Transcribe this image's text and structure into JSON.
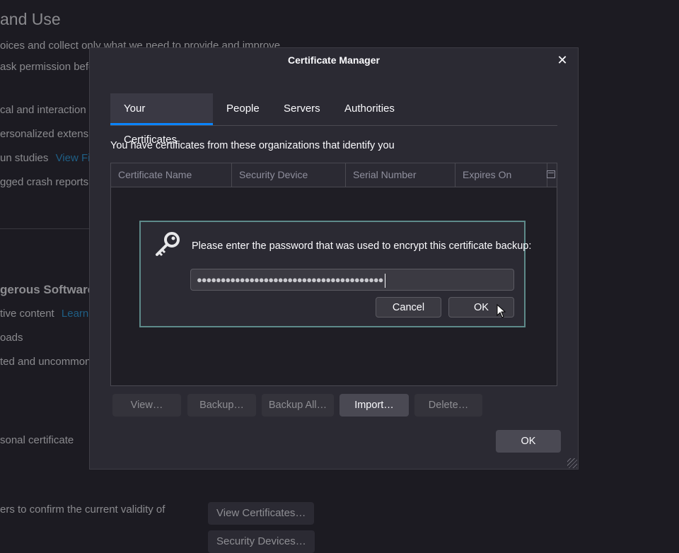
{
  "background": {
    "heading": "and Use",
    "line1": "oices and collect only what we need to provide and improve",
    "line2": "ask permission befo",
    "line3": "cal and interaction d",
    "line4": "ersonalized extensio",
    "line5": "un studies",
    "line5_link": "View Fi",
    "line6": "gged crash reports",
    "section2_heading": "gerous Software",
    "line7": "tive content",
    "line7_link": "Learn",
    "line8": "oads",
    "line9": "ted and uncommon",
    "line10": "sonal certificate",
    "line11": "ers to confirm the current validity of",
    "view_certificates": "View Certificates…",
    "security_devices": "Security Devices…"
  },
  "dialog": {
    "title": "Certificate Manager",
    "close_label": "✕",
    "tabs": [
      {
        "label": "Your Certificates",
        "active": true
      },
      {
        "label": "People",
        "active": false
      },
      {
        "label": "Servers",
        "active": false
      },
      {
        "label": "Authorities",
        "active": false
      }
    ],
    "intro": "You have certificates from these organizations that identify you",
    "columns": [
      "Certificate Name",
      "Security Device",
      "Serial Number",
      "Expires On"
    ],
    "buttons": {
      "view": "View…",
      "backup": "Backup…",
      "backup_all": "Backup All…",
      "import": "Import…",
      "delete": "Delete…"
    },
    "ok": "OK"
  },
  "prompt": {
    "message": "Please enter the password that was used to encrypt this certificate backup:",
    "password_masked": "●●●●●●●●●●●●●●●●●●●●●●●●●●●●●●●●●●●●●●●",
    "cancel": "Cancel",
    "ok": "OK"
  },
  "colors": {
    "accent": "#0a84ff",
    "prompt_border": "#5e8a8a",
    "link": "#1f5f86"
  },
  "icons": {
    "prompt_icon": "key-icon",
    "close": "close-icon",
    "column_picker": "column-picker-icon",
    "pointer": "mouse-cursor-icon"
  }
}
